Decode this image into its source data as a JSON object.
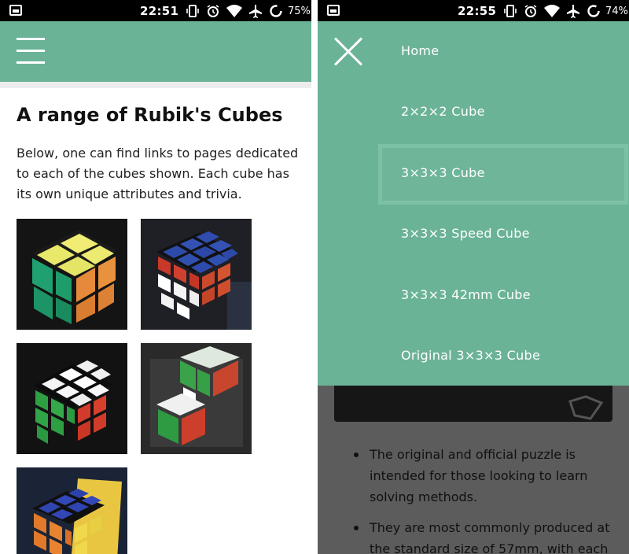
{
  "left_screen": {
    "status": {
      "time": "22:51",
      "battery": "75%"
    },
    "page": {
      "title": "A range of Rubik's Cubes",
      "intro": "Below, one can find links to pages dedicated to each of the cubes shown. Each cube has its own unique attributes and trivia."
    },
    "thumbnails": [
      {
        "subject": "2x2x2 cube photo"
      },
      {
        "subject": "3x3x3 cube photo"
      },
      {
        "subject": "3x3x3 speed cube photo"
      },
      {
        "subject": "3x3x3 42mm cube photo"
      },
      {
        "subject": "original 3x3x3 cube with solution booklet photo"
      }
    ]
  },
  "right_screen": {
    "status": {
      "time": "22:55",
      "battery": "74%"
    },
    "nav": {
      "items": [
        {
          "label": "Home"
        },
        {
          "label": "2×2×2 Cube"
        },
        {
          "label": "3×3×3 Cube"
        },
        {
          "label": "3×3×3 Speed Cube"
        },
        {
          "label": "3×3×3 42mm Cube"
        },
        {
          "label": "Original 3×3×3 Cube"
        }
      ],
      "active": "3×3×3 Cube"
    },
    "background_bullets": [
      "The original and official puzzle is intended for those looking to learn solving methods.",
      "They are most commonly produced at the standard size of 57mm, with each"
    ]
  },
  "colors": {
    "accent": "#6bb397",
    "active_outline": "#7cc0a6",
    "dim_overlay": "#5c5c5c"
  }
}
